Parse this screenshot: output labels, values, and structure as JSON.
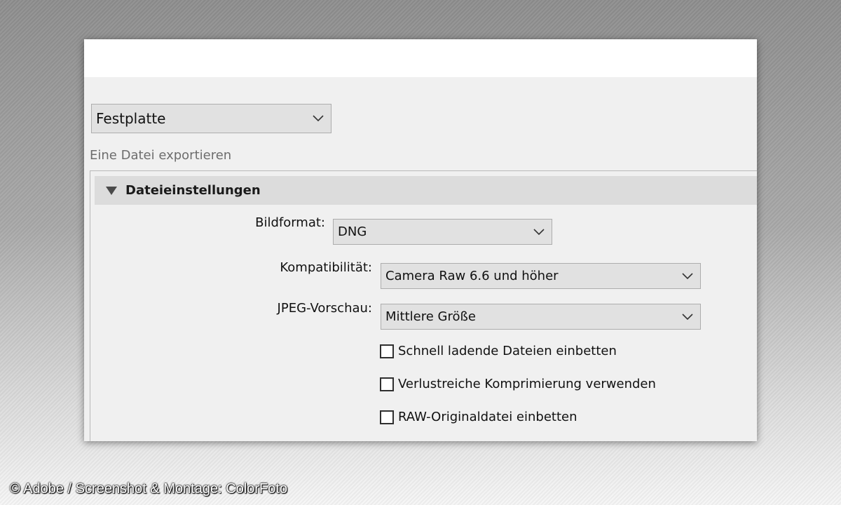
{
  "destination": {
    "selected": "Festplatte"
  },
  "subtitle": "Eine Datei exportieren",
  "section": {
    "title": "Dateieinstellungen",
    "expanded": true
  },
  "fields": {
    "format_label": "Bildformat:",
    "format_value": "DNG",
    "compat_label": "Kompatibilität:",
    "compat_value": "Camera Raw 6.6 und höher",
    "jpeg_label": "JPEG-Vorschau:",
    "jpeg_value": "Mittlere Größe"
  },
  "checkboxes": [
    {
      "label": "Schnell ladende Dateien einbetten",
      "checked": false
    },
    {
      "label": "Verlustreiche Komprimierung verwenden",
      "checked": false
    },
    {
      "label": "RAW-Originaldatei einbetten",
      "checked": false
    }
  ],
  "credit": "© Adobe / Screenshot & Montage: ColorFoto",
  "icons": {
    "dropdown": "chevron-down-icon",
    "section_toggle": "triangle-down-icon"
  },
  "colors": {
    "panel_bg": "#f0f0f0",
    "select_bg": "#e1e1e1",
    "header_bg": "#dcdcdc"
  }
}
